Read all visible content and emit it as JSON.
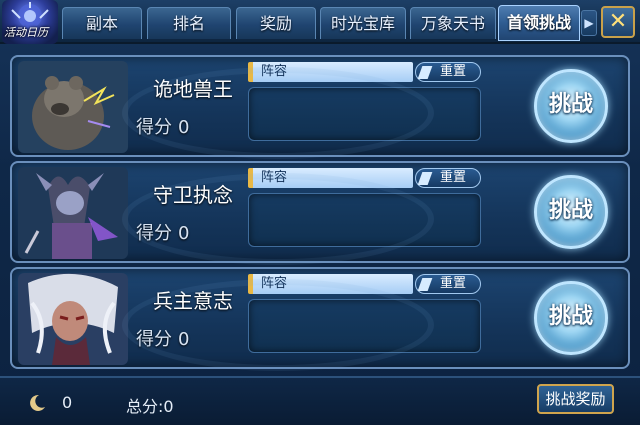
{
  "logo": {
    "text": "活动日历"
  },
  "tabs": [
    {
      "label": "副本",
      "active": false
    },
    {
      "label": "排名",
      "active": false
    },
    {
      "label": "奖励",
      "active": false
    },
    {
      "label": "时光宝库",
      "active": false
    },
    {
      "label": "万象天书",
      "active": false
    },
    {
      "label": "首领挑战",
      "active": true
    }
  ],
  "tab_more_icon": "chevron-right-icon",
  "close_icon": "close-icon",
  "bosses": [
    {
      "name": "诡地兽王",
      "score_label": "得分",
      "score": "0",
      "lineup_label": "阵容",
      "reset_label": "重置",
      "challenge_label": "挑战",
      "portrait": "bear-beast-portrait"
    },
    {
      "name": "守卫执念",
      "score_label": "得分",
      "score": "0",
      "lineup_label": "阵容",
      "reset_label": "重置",
      "challenge_label": "挑战",
      "portrait": "horned-guardian-portrait"
    },
    {
      "name": "兵主意志",
      "score_label": "得分",
      "score": "0",
      "lineup_label": "阵容",
      "reset_label": "重置",
      "challenge_label": "挑战",
      "portrait": "white-haired-warlord-portrait"
    }
  ],
  "footer": {
    "moon_icon": "crescent-moon-icon",
    "moon_count": "0",
    "total_text": "总分:0",
    "reward_label": "挑战奖励"
  },
  "colors": {
    "accent_gold": "#cfa44d",
    "panel_border": "#6a8fbc",
    "lineup_bar": "#a6cdf5"
  }
}
